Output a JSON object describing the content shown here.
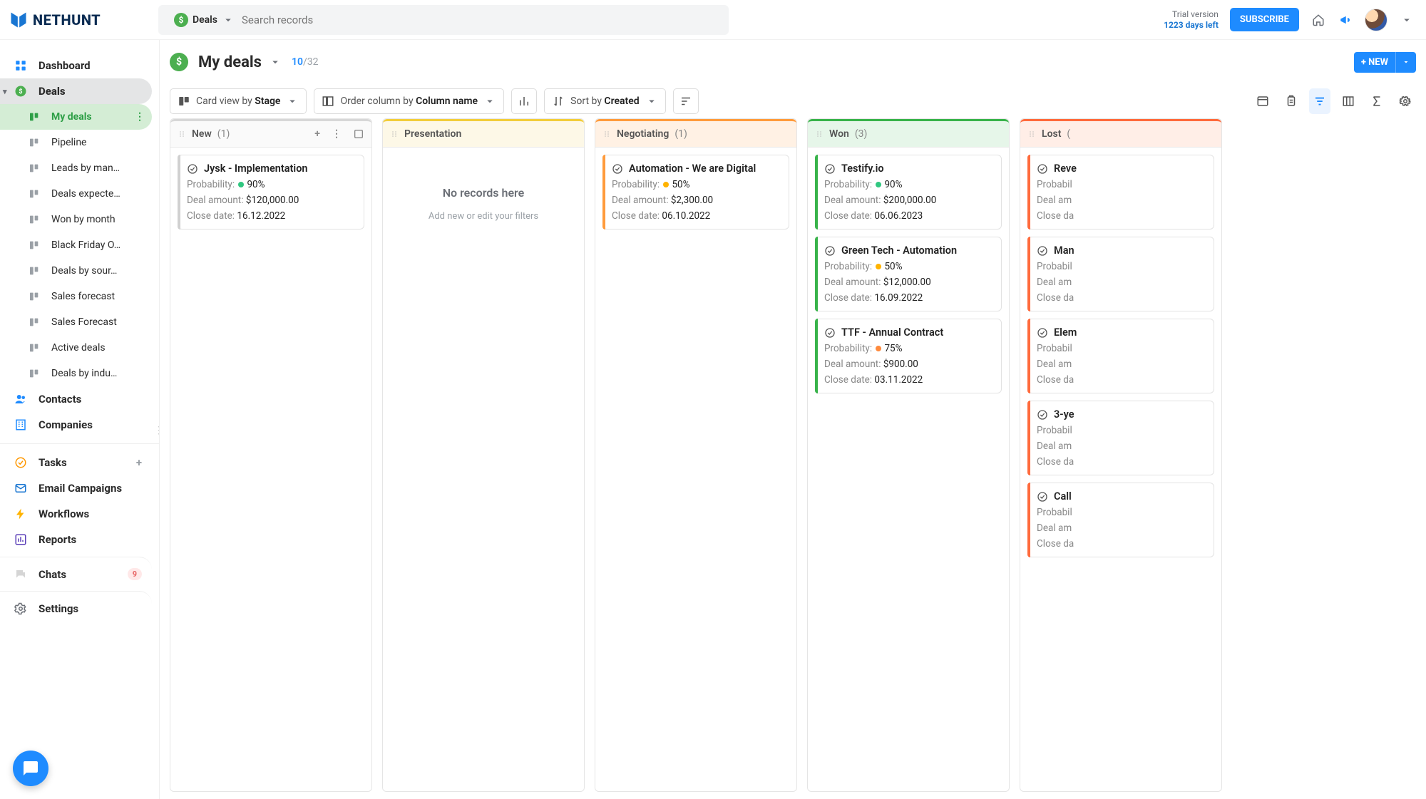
{
  "app": {
    "brand": "NETHUNT"
  },
  "search": {
    "scope": "Deals",
    "placeholder": "Search records"
  },
  "trial": {
    "line1": "Trial version",
    "line2": "1223 days left"
  },
  "header": {
    "subscribe": "SUBSCRIBE"
  },
  "sidebar": {
    "dashboard": "Dashboard",
    "deals": "Deals",
    "views": [
      "My deals",
      "Pipeline",
      "Leads by man…",
      "Deals expecte…",
      "Won by month",
      "Black Friday O…",
      "Deals by sour…",
      "Sales forecast",
      "Sales Forecast",
      "Active deals",
      "Deals by indu…"
    ],
    "contacts": "Contacts",
    "companies": "Companies",
    "tasks": "Tasks",
    "email": "Email Campaigns",
    "workflows": "Workflows",
    "reports": "Reports",
    "chats": "Chats",
    "chats_badge": "9",
    "settings": "Settings"
  },
  "page": {
    "title": "My deals",
    "count_current": "10",
    "count_total": "/32",
    "new_button": "+ NEW"
  },
  "toolbar": {
    "cardview_prefix": "Card view by ",
    "cardview_value": "Stage",
    "order_prefix": "Order column by ",
    "order_value": "Column name",
    "sort_prefix": "Sort by ",
    "sort_value": "Created"
  },
  "labels": {
    "probability": "Probability: ",
    "amount": "Deal amount: ",
    "close": "Close date: ",
    "empty_title": "No records here",
    "empty_sub": "Add new or edit your filters"
  },
  "columns": [
    {
      "key": "new",
      "name": "New",
      "count": "(1)",
      "has_actions": true,
      "cards": [
        {
          "title": "Jysk - Implementation",
          "prob": "90%",
          "prob_dot": "green",
          "amount": "$120,000.00",
          "close": "16.12.2022"
        }
      ]
    },
    {
      "key": "presentation",
      "name": "Presentation",
      "count": "",
      "empty": true,
      "cards": []
    },
    {
      "key": "negotiating",
      "name": "Negotiating",
      "count": "(1)",
      "cards": [
        {
          "title": "Automation - We are Digital",
          "prob": "50%",
          "prob_dot": "amber",
          "amount": "$2,300.00",
          "close": "06.10.2022"
        }
      ]
    },
    {
      "key": "won",
      "name": "Won",
      "count": "(3)",
      "cards": [
        {
          "title": "Testify.io",
          "prob": "90%",
          "prob_dot": "green",
          "amount": "$200,000.00",
          "close": "06.06.2023"
        },
        {
          "title": "Green Tech - Automation",
          "prob": "50%",
          "prob_dot": "amber",
          "amount": "$12,000.00",
          "close": "16.09.2022"
        },
        {
          "title": "TTF - Annual Contract",
          "prob": "75%",
          "prob_dot": "orange",
          "amount": "$900.00",
          "close": "03.11.2022"
        }
      ]
    },
    {
      "key": "lost",
      "name": "Lost",
      "count": "(",
      "cards": [
        {
          "title": "Reve",
          "prob": "",
          "amount": "",
          "close": ""
        },
        {
          "title": "Man",
          "prob": "",
          "amount": "",
          "close": ""
        },
        {
          "title": "Elem",
          "prob": "",
          "amount": "",
          "close": ""
        },
        {
          "title": "3-ye",
          "prob": "",
          "amount": "",
          "close": ""
        },
        {
          "title": "Call",
          "prob": "",
          "amount": "",
          "close": ""
        }
      ]
    }
  ]
}
